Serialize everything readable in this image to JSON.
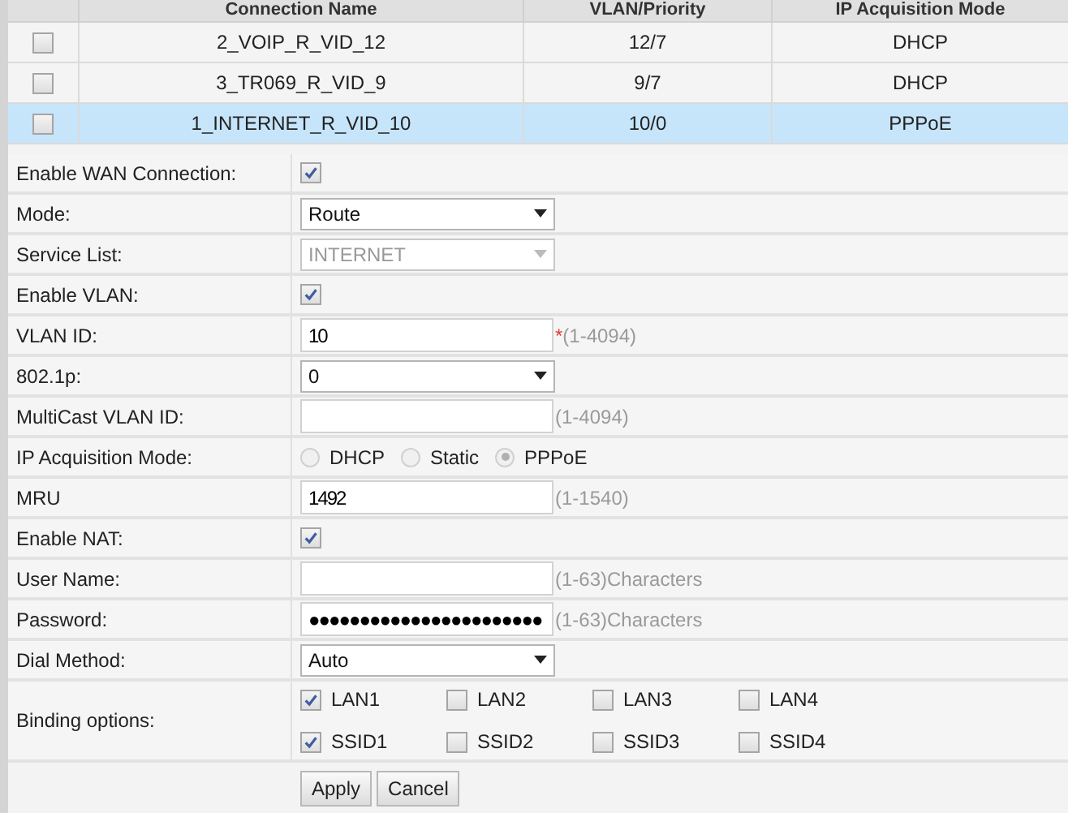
{
  "table": {
    "columns": [
      "Connection Name",
      "VLAN/Priority",
      "IP Acquisition Mode"
    ],
    "rows": [
      {
        "checked": false,
        "selected": false,
        "cells": [
          "2_VOIP_R_VID_12",
          "12/7",
          "DHCP"
        ]
      },
      {
        "checked": false,
        "selected": false,
        "cells": [
          "3_TR069_R_VID_9",
          "9/7",
          "DHCP"
        ]
      },
      {
        "checked": false,
        "selected": true,
        "cells": [
          "1_INTERNET_R_VID_10",
          "10/0",
          "PPPoE"
        ]
      }
    ]
  },
  "form": [
    {
      "kind": "checkbox",
      "label": "Enable WAN Connection:",
      "checked": true
    },
    {
      "kind": "select",
      "label": "Mode:",
      "value": "Route",
      "disabled": false
    },
    {
      "kind": "select",
      "label": "Service List:",
      "value": "INTERNET",
      "disabled": true
    },
    {
      "kind": "checkbox",
      "label": "Enable VLAN:",
      "checked": true
    },
    {
      "kind": "text",
      "label": "VLAN ID:",
      "value": "10",
      "required_mark": "*",
      "hint": "(1-4094)"
    },
    {
      "kind": "select",
      "label": "802.1p:",
      "value": "0",
      "disabled": false
    },
    {
      "kind": "text",
      "label": "MultiCast VLAN ID:",
      "hint": "(1-4094)"
    },
    {
      "kind": "radio",
      "label": "IP Acquisition Mode:",
      "options": [
        {
          "label": "DHCP",
          "selected": false
        },
        {
          "label": "Static",
          "selected": false
        },
        {
          "label": "PPPoE",
          "selected": true
        }
      ]
    },
    {
      "kind": "text",
      "label": "MRU",
      "value": "1492",
      "hint": "(1-1540)"
    },
    {
      "kind": "checkbox",
      "label": "Enable NAT:",
      "checked": true
    },
    {
      "kind": "text",
      "label": "User Name:",
      "hint": "(1-63)Characters"
    },
    {
      "kind": "text",
      "label": "Password:",
      "value": "●●●●●●●●●●●●●●●●●●●●●●●",
      "hint": "(1-63)Characters"
    },
    {
      "kind": "select",
      "label": "Dial Method:",
      "value": "Auto",
      "disabled": false
    },
    {
      "kind": "binding",
      "label": "Binding options:",
      "options": [
        {
          "label": "LAN1",
          "checked": true
        },
        {
          "label": "LAN2",
          "checked": false
        },
        {
          "label": "LAN3",
          "checked": false
        },
        {
          "label": "LAN4",
          "checked": false
        },
        {
          "label": "SSID1",
          "checked": true
        },
        {
          "label": "SSID2",
          "checked": false
        },
        {
          "label": "SSID3",
          "checked": false
        },
        {
          "label": "SSID4",
          "checked": false
        }
      ]
    }
  ],
  "buttons": [
    "Apply",
    "Cancel"
  ]
}
